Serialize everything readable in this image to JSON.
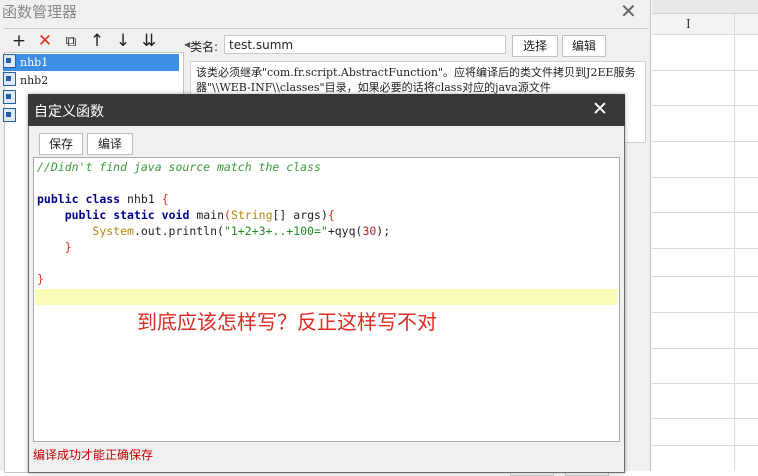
{
  "manager": {
    "title": "函数管理器",
    "toolbar": {
      "add": "+",
      "delete": "✕",
      "copy": "⧉",
      "up": "↑",
      "down": "↓",
      "sort": "⇊"
    },
    "functions": [
      {
        "name": "nhb1"
      },
      {
        "name": "nhb2"
      },
      {
        "name": ""
      },
      {
        "name": ""
      }
    ],
    "classname_label": "类名:",
    "classname_value": "test.summ",
    "choose_label": "选择",
    "edit_label": "编辑",
    "description": "该类必须继承\"com.fr.script.AbstractFunction\"。应将编译后的类文件拷贝到J2EE服务器\"\\\\WEB-INF\\\\classes\"目录，如果必要的话将class对应的java源文件"
  },
  "sheet": {
    "cursor": "I"
  },
  "custom_dialog": {
    "title": "自定义函数",
    "save_label": "保存",
    "compile_label": "编译",
    "code": {
      "comment": "//Didn't find java source match the class",
      "kw_public": "public",
      "kw_class": "class",
      "class_name": "nhb1",
      "kw_static": "static",
      "kw_void": "void",
      "method": "main",
      "string_type": "String",
      "params": "[] args)",
      "system": "System",
      "println": ".out.println(",
      "literal": "\"1+2+3+..+100=\"",
      "call": "+qyq(",
      "arg": "30",
      "end": ");"
    },
    "overlay_note": "到底应该怎样写？反正这样写不对",
    "status": "编译成功才能正确保存"
  }
}
